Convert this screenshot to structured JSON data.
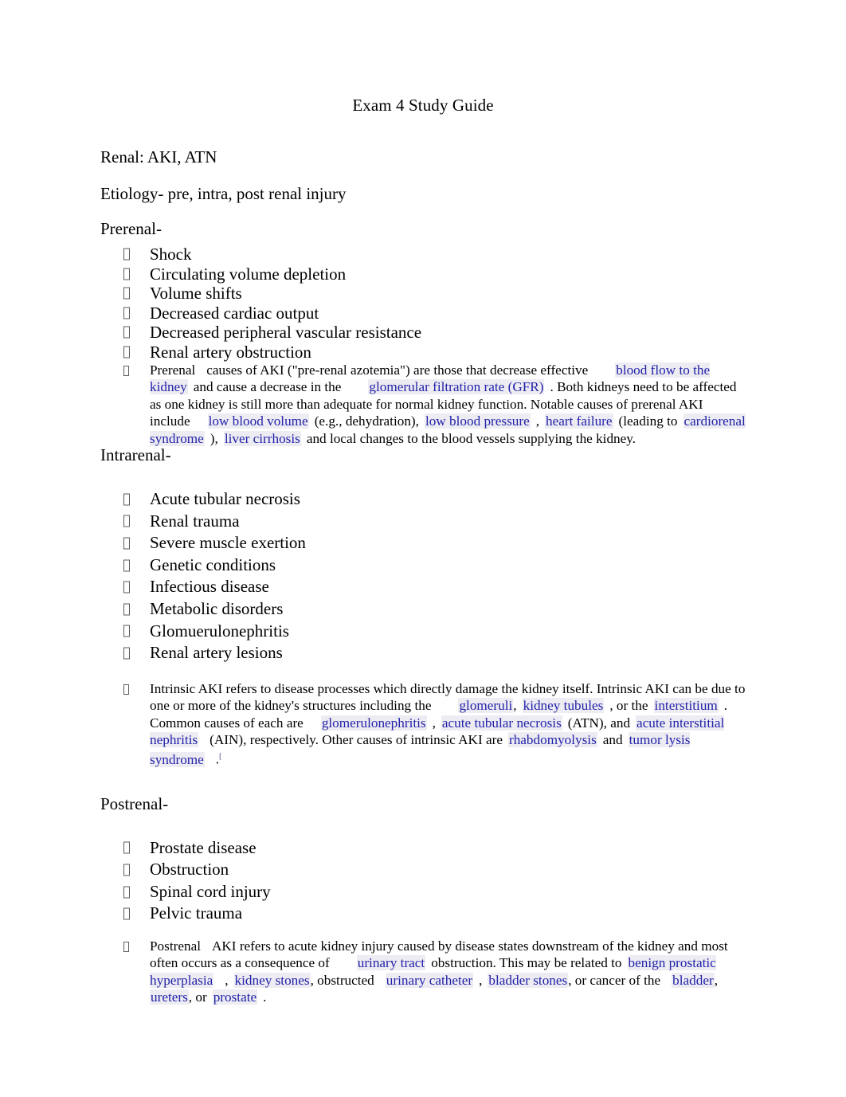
{
  "document": {
    "title": "Exam 4 Study Guide",
    "headings": {
      "topic": "Renal: AKI, ATN",
      "etiology": "Etiology- pre, intra, post renal injury",
      "prerenal": "Prerenal-",
      "intrarenal": "Intrarenal-",
      "postrenal": "Postrenal-"
    },
    "prerenal_list": [
      "Shock",
      "Circulating volume depletion",
      "Volume shifts",
      "Decreased cardiac output",
      "Decreased peripheral vascular resistance",
      "Renal artery obstruction"
    ],
    "prerenal_note": {
      "t1": "Prerenal",
      "t2": "causes of AKI (\"pre-renal azotemia\") are those that decrease effective",
      "link1": "blood flow to the kidney",
      "t3": "and cause a decrease in the",
      "link2": "glomerular filtration rate (GFR)",
      "t4": ". Both kidneys need to be affected as one kidney is still more than adequate for normal kidney function. Notable causes of prerenal AKI include",
      "link3": "low blood volume",
      "t5": "(e.g., dehydration),",
      "link4": "low blood pressure",
      "t6": ",",
      "link5": "heart failure",
      "t7": "(leading to",
      "link6": "cardiorenal syndrome",
      "t8": "),",
      "link7": "liver cirrhosis",
      "t9": "and local changes to the blood vessels supplying the kidney."
    },
    "intrarenal_list": [
      "Acute tubular necrosis",
      "Renal trauma",
      "Severe muscle exertion",
      "Genetic conditions",
      "Infectious disease",
      "Metabolic disorders",
      "Glomuerulonephritis",
      "Renal artery lesions"
    ],
    "intrarenal_note": {
      "t1": "Intrinsic AKI refers to disease processes which directly damage the kidney itself. Intrinsic AKI can be due to one or more of the kidney's structures including the",
      "link1": "glomeruli",
      "t2": ",",
      "link2": "kidney tubules",
      "t3": ", or the",
      "link3": "interstitium",
      "t4": ". Common causes of each are",
      "link4": "glomerulonephritis",
      "t5": ",",
      "link5": "acute tubular necrosis",
      "t6": "(ATN), and",
      "link6": "acute interstitial nephritis",
      "t7": "(AIN), respectively. Other causes of intrinsic AKI are",
      "link7": "rhabdomyolysis",
      "t8": "and",
      "link8": "tumor lysis syndrome",
      "t9": ".",
      "artifact": "["
    },
    "postrenal_list": [
      "Prostate disease",
      "Obstruction",
      "Spinal cord injury",
      "Pelvic trauma"
    ],
    "postrenal_note": {
      "t1": "Postrenal",
      "t2": "AKI refers to acute kidney injury caused by disease states downstream of the kidney and most often occurs as a consequence of",
      "link1": "urinary tract",
      "t3": "obstruction. This may be related to",
      "link2": "benign prostatic hyperplasia",
      "t4": ",",
      "link3": "kidney stones",
      "t5": ", obstructed",
      "link4": "urinary catheter",
      "t6": ",",
      "link5": "bladder stones",
      "t7": ", or cancer of the",
      "link6": "bladder",
      "t8": ",",
      "link7": "ureters",
      "t9": ", or",
      "link8": "prostate",
      "t10": "."
    },
    "colors": {
      "link": "#2222aa",
      "text": "#000000",
      "highlight": "#dedce8",
      "background": "#ffffff"
    }
  }
}
